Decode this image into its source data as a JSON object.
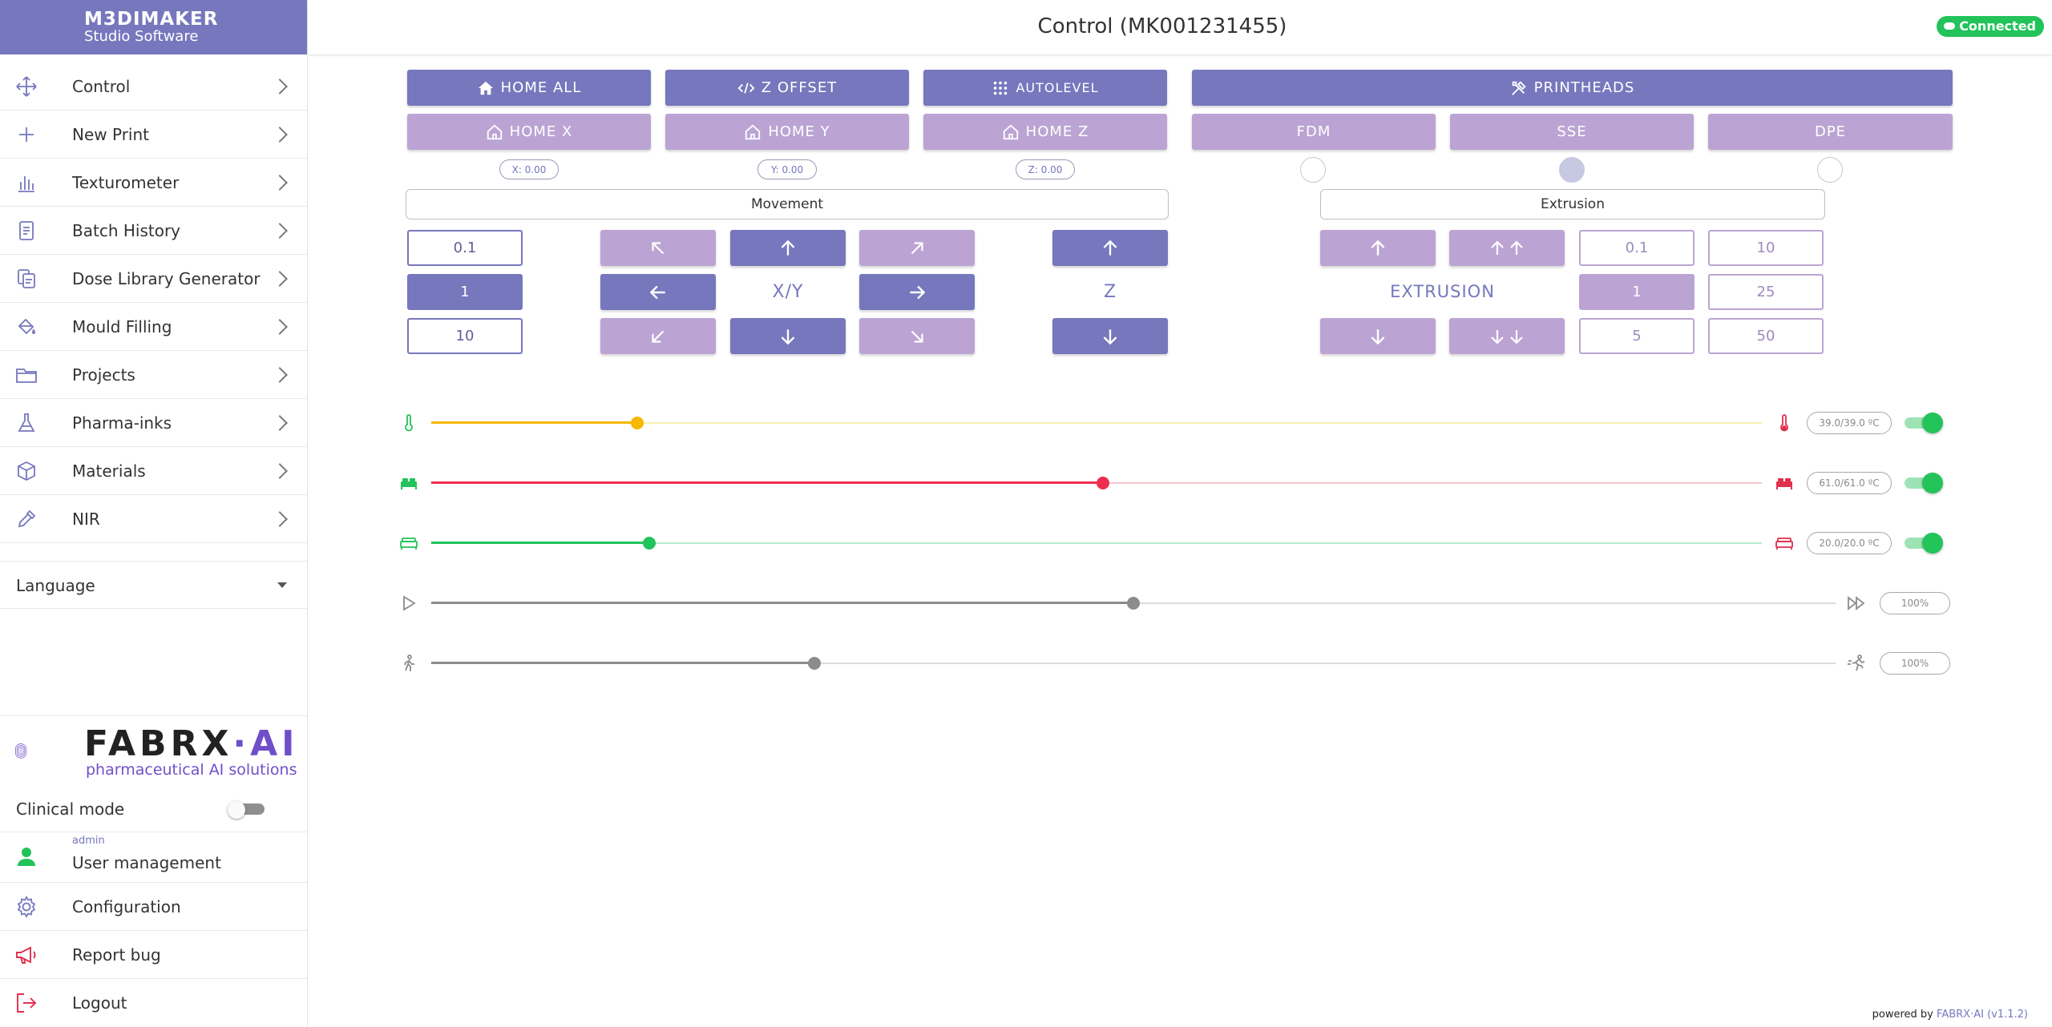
{
  "brand": {
    "line1": "M3DIMAKER",
    "line2": "Studio Software"
  },
  "nav": [
    {
      "label": "Control",
      "icon": "move-arrows-icon"
    },
    {
      "label": "New Print",
      "icon": "plus-icon"
    },
    {
      "label": "Texturometer",
      "icon": "bar-chart-icon"
    },
    {
      "label": "Batch History",
      "icon": "document-icon"
    },
    {
      "label": "Dose Library Generator",
      "icon": "copy-document-icon"
    },
    {
      "label": "Mould Filling",
      "icon": "paint-bucket-icon"
    },
    {
      "label": "Projects",
      "icon": "folder-icon"
    },
    {
      "label": "Pharma-inks",
      "icon": "flask-icon"
    },
    {
      "label": "Materials",
      "icon": "cube-icon"
    },
    {
      "label": "NIR",
      "icon": "pipette-icon"
    }
  ],
  "language": {
    "label": "Language"
  },
  "logo": {
    "word_main": "FABRX",
    "word_sep": "·",
    "word_ai": "AI",
    "tagline": "pharmaceutical AI solutions"
  },
  "clinical_mode": {
    "label": "Clinical mode",
    "enabled": false
  },
  "user": {
    "role": "admin",
    "label": "User management"
  },
  "bottom_nav": [
    {
      "label": "Configuration",
      "icon": "gear-icon"
    },
    {
      "label": "Report bug",
      "icon": "megaphone-icon"
    },
    {
      "label": "Logout",
      "icon": "logout-icon"
    }
  ],
  "header": {
    "title": "Control (MK001231455)",
    "status": "Connected"
  },
  "top_buttons": {
    "home_all": "HOME ALL",
    "z_offset": "Z OFFSET",
    "autolevel": "AUTOLEVEL",
    "printheads": "PRINTHEADS"
  },
  "home_buttons": {
    "home_x": "HOME X",
    "home_y": "HOME Y",
    "home_z": "HOME Z"
  },
  "positions": {
    "x": "X: 0.00",
    "y": "Y: 0.00",
    "z": "Z: 0.00"
  },
  "heads": {
    "fdm": "FDM",
    "sse": "SSE",
    "dpe": "DPE",
    "selected": "SSE"
  },
  "movement": {
    "label": "Movement",
    "steps": [
      "0.1",
      "1",
      "10"
    ],
    "selected_step": "1",
    "xy_label": "X/Y",
    "z_label": "Z"
  },
  "extrusion": {
    "label": "Extrusion",
    "center_label": "EXTRUSION",
    "steps": [
      "0.1",
      "10",
      "1",
      "25",
      "5",
      "50"
    ],
    "selected_step": "1"
  },
  "sliders": [
    {
      "name": "nozzle-temperature",
      "value_text": "39.0/39.0 ºC",
      "fraction": 0.155,
      "color": "#f6b800",
      "rail": "#f7efb0",
      "toggle": true
    },
    {
      "name": "bed-temperature",
      "value_text": "61.0/61.0 ºC",
      "fraction": 0.505,
      "color": "#ee2e4f",
      "rail": "#f8c6cd",
      "toggle": true
    },
    {
      "name": "chamber-temperature",
      "value_text": "20.0/20.0 ºC",
      "fraction": 0.164,
      "color": "#21c35a",
      "rail": "#b9ecd0",
      "toggle": true
    },
    {
      "name": "print-speed",
      "value_text": "100%",
      "fraction": 0.5,
      "color": "#8c8c8c",
      "rail": "#dcdcdc",
      "toggle": false
    },
    {
      "name": "flow-rate",
      "value_text": "100%",
      "fraction": 0.273,
      "color": "#8c8c8c",
      "rail": "#dcdcdc",
      "toggle": false
    }
  ],
  "footer": {
    "prefix": "powered by",
    "brand": "FABRX·AI",
    "version": "(v1.1.2)"
  }
}
